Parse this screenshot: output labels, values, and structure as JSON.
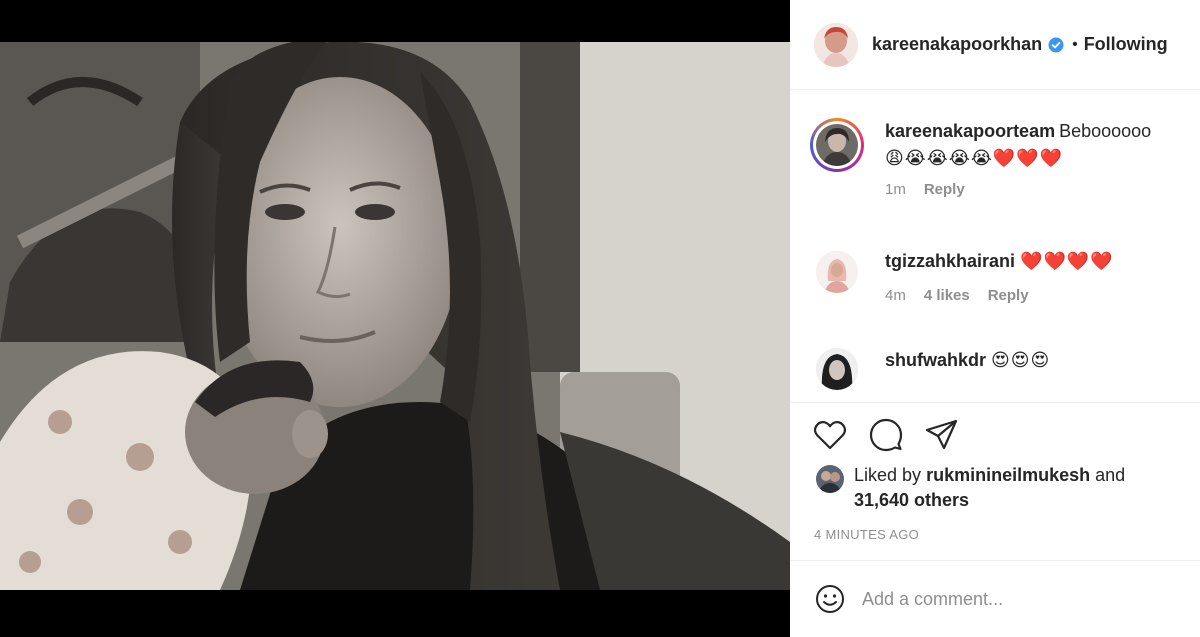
{
  "post": {
    "author": "kareenakapoorkhan",
    "verified": true,
    "follow_state": "Following",
    "separator": "•",
    "photo_icon": "photo-mother-and-baby"
  },
  "comments": [
    {
      "username": "kareenakapoorteam",
      "text": "Beboooooo",
      "emojis": "😩😭😭😭😭❤️❤️❤️",
      "time": "1m",
      "likes": "",
      "reply_label": "Reply",
      "has_story": true
    },
    {
      "username": "tgizzahkhairani",
      "text": "",
      "emojis": "❤️❤️❤️❤️",
      "time": "4m",
      "likes": "4 likes",
      "reply_label": "Reply",
      "has_story": false
    },
    {
      "username": "shufwahkdr",
      "text": "",
      "emojis": "😍😍😍",
      "time": "",
      "likes": "",
      "reply_label": "",
      "has_story": false
    }
  ],
  "actions": {
    "like_icon": "heart-icon",
    "comment_icon": "comment-bubble-icon",
    "share_icon": "paper-plane-icon"
  },
  "likes": {
    "prefix": "Liked by",
    "user": "rukminineilmukesh",
    "conjunction": "and",
    "others": "31,640 others"
  },
  "timestamp": "4 MINUTES AGO",
  "add_comment": {
    "placeholder": "Add a comment...",
    "emoji_icon": "smiley-icon"
  },
  "colors": {
    "text": "#262626",
    "secondary": "#8e8e8e",
    "verified": "#3897f0",
    "border": "#efefef"
  }
}
